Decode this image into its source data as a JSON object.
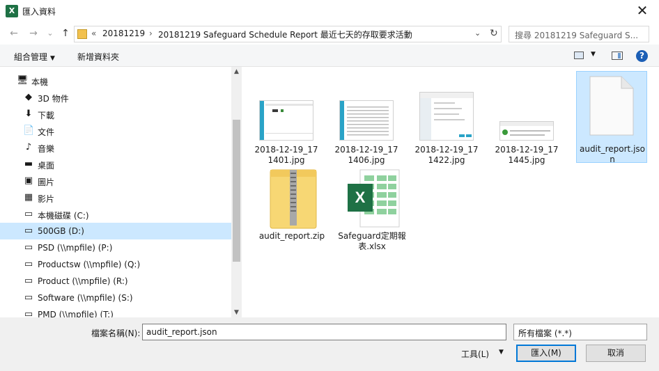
{
  "window": {
    "title": "匯入資料",
    "app_icon": "X",
    "close_label": "✕"
  },
  "nav": {
    "back": "←",
    "forward": "→",
    "recent": "⌄",
    "up": "↑",
    "address": {
      "overflow": "«",
      "crumbs": [
        "20181219",
        "20181219 Safeguard Schedule Report 最近七天的存取要求活動"
      ],
      "separator": "›",
      "dropdown": "⌄",
      "refresh": "↻"
    },
    "search_placeholder": "搜尋 20181219 Safeguard S..."
  },
  "toolbar": {
    "organize": "組合管理",
    "new_folder": "新增資料夾",
    "help": "?"
  },
  "sidebar": {
    "items": [
      {
        "label": "本機",
        "icon": "computer-icon",
        "glyph": "🖥"
      },
      {
        "label": "3D 物件",
        "icon": "cube-icon",
        "glyph": "◆"
      },
      {
        "label": "下載",
        "icon": "download-icon",
        "glyph": "⬇"
      },
      {
        "label": "文件",
        "icon": "document-icon",
        "glyph": "📄"
      },
      {
        "label": "音樂",
        "icon": "music-icon",
        "glyph": "♪"
      },
      {
        "label": "桌面",
        "icon": "desktop-icon",
        "glyph": "▬"
      },
      {
        "label": "圖片",
        "icon": "pictures-icon",
        "glyph": "▣"
      },
      {
        "label": "影片",
        "icon": "video-icon",
        "glyph": "▦"
      },
      {
        "label": "本機磁碟 (C:)",
        "icon": "system-drive-icon",
        "glyph": "▭"
      },
      {
        "label": "500GB (D:)",
        "icon": "drive-icon",
        "glyph": "▭"
      },
      {
        "label": "PSD (\\\\mpfile) (P:)",
        "icon": "network-drive-icon",
        "glyph": "▭"
      },
      {
        "label": "Productsw (\\\\mpfile) (Q:)",
        "icon": "network-drive-icon",
        "glyph": "▭"
      },
      {
        "label": "Product (\\\\mpfile) (R:)",
        "icon": "network-drive-icon",
        "glyph": "▭"
      },
      {
        "label": "Software (\\\\mpfile) (S:)",
        "icon": "network-drive-icon",
        "glyph": "▭"
      },
      {
        "label": "PMD (\\\\mpfile) (T:)",
        "icon": "network-drive-icon",
        "glyph": "▭"
      }
    ],
    "selected_index": 9
  },
  "files": [
    {
      "name": "2018-12-19_171401.jpg",
      "kind": "image"
    },
    {
      "name": "2018-12-19_171406.jpg",
      "kind": "image"
    },
    {
      "name": "2018-12-19_171422.jpg",
      "kind": "image"
    },
    {
      "name": "2018-12-19_171445.jpg",
      "kind": "image"
    },
    {
      "name": "audit_report.json",
      "kind": "blank",
      "selected": true
    },
    {
      "name": "audit_report.zip",
      "kind": "zip"
    },
    {
      "name": "Safeguard定期報表.xlsx",
      "kind": "excel"
    }
  ],
  "footer": {
    "filename_label": "檔案名稱(N):",
    "filename_value": "audit_report.json",
    "filetype_value": "所有檔案 (*.*)",
    "tools_label": "工具(L)",
    "open_label": "匯入(M)",
    "cancel_label": "取消"
  },
  "colors": {
    "selection": "#cce8ff",
    "accent": "#0078d7",
    "excel": "#1e7145"
  }
}
